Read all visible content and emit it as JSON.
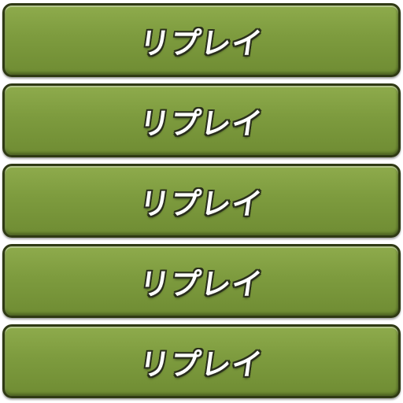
{
  "buttons": [
    {
      "label": "リプレイ"
    },
    {
      "label": "リプレイ"
    },
    {
      "label": "リプレイ"
    },
    {
      "label": "リプレイ"
    },
    {
      "label": "リプレイ"
    }
  ]
}
